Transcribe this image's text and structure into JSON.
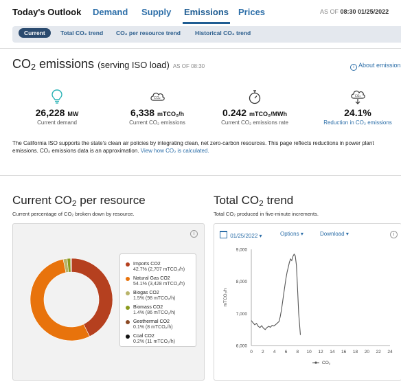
{
  "topnav": {
    "brand": "Today's Outlook",
    "tabs": [
      {
        "label": "Demand"
      },
      {
        "label": "Supply"
      },
      {
        "label": "Emissions"
      },
      {
        "label": "Prices"
      }
    ],
    "asof_prefix": "AS OF",
    "asof_value": "08:30 01/25/2022"
  },
  "subnav": {
    "items": [
      {
        "label": "Current"
      },
      {
        "label": "Total CO₂ trend"
      },
      {
        "label": "CO₂ per resource trend"
      },
      {
        "label": "Historical CO₂ trend"
      }
    ]
  },
  "emissions_header": {
    "title_pre": "CO",
    "title_sub": "2",
    "title_post": " emissions",
    "serving": "(serving ISO load)",
    "asof": "AS OF 08:30",
    "about": "About emissions"
  },
  "kpis": [
    {
      "value": "26,228",
      "unit": "MW",
      "caption": "Current demand",
      "icon": "lightbulb-icon"
    },
    {
      "value": "6,338",
      "unit": "mTCO₂/h",
      "caption": "Current CO₂ emissions",
      "icon": "cloud-co2-icon"
    },
    {
      "value": "0.242",
      "unit": "mTCO₂/MWh",
      "caption": "Current CO₂ emissions rate",
      "icon": "stopwatch-icon"
    },
    {
      "value": "24.1%",
      "unit": "",
      "caption": "Reduction in CO₂ emissions",
      "icon": "cloud-down-icon"
    }
  ],
  "description": {
    "text": "The California ISO supports the state's clean air policies by integrating clean, net zero-carbon resources. This page reflects reductions in power plant emissions. CO₂ emissions data is an approximation.",
    "link": "View how CO₂ is calculated."
  },
  "per_resource": {
    "title_pre": "Current CO",
    "title_sub": "2",
    "title_post": " per resource",
    "subtitle": "Current percentage of CO₂ broken down by resource.",
    "legend": [
      {
        "name": "Imports CO2",
        "detail": "42.7% (2,707 mTCO₂/h)",
        "color": "#b5401f"
      },
      {
        "name": "Natural Gas CO2",
        "detail": "54.1% (3,428 mTCO₂/h)",
        "color": "#e8730c"
      },
      {
        "name": "Biogas CO2",
        "detail": "1.5% (98 mTCO₂/h)",
        "color": "#b9b46a"
      },
      {
        "name": "Biomass CO2",
        "detail": "1.4% (86 mTCO₂/h)",
        "color": "#8a9a1c"
      },
      {
        "name": "Geothermal CO2",
        "detail": "0.1% (8 mTCO₂/h)",
        "color": "#8b4a24"
      },
      {
        "name": "Coal CO2",
        "detail": "0.2% (11 mTCO₂/h)",
        "color": "#111111"
      }
    ]
  },
  "trend": {
    "title_pre": "Total CO",
    "title_sub": "2",
    "title_post": " trend",
    "subtitle": "Total CO₂ produced in five-minute increments.",
    "date": "01/25/2022",
    "options": "Options",
    "download": "Download",
    "ylabel": "mTCO₂/h",
    "legend": "CO₂"
  },
  "chart_data": [
    {
      "type": "pie",
      "title": "",
      "labels": [
        "Imports CO2",
        "Natural Gas CO2",
        "Biogas CO2",
        "Biomass CO2",
        "Geothermal CO2",
        "Coal CO2"
      ],
      "values": [
        2707,
        3428,
        98,
        86,
        8,
        11
      ],
      "colors": [
        "#b5401f",
        "#e8730c",
        "#b9b46a",
        "#8a9a1c",
        "#8b4a24",
        "#111111"
      ],
      "donut": true
    },
    {
      "type": "line",
      "title": "",
      "xlabel": "",
      "ylabel": "mTCO₂/h",
      "xlim": [
        0,
        24
      ],
      "ylim": [
        6000,
        9000
      ],
      "xticks": [
        0,
        2,
        4,
        6,
        8,
        10,
        12,
        14,
        16,
        18,
        20,
        22,
        24
      ],
      "yticks": [
        6000,
        7000,
        8000,
        9000
      ],
      "ytick_labels": [
        "6,000",
        "7,000",
        "8,000",
        "9,000"
      ],
      "grid": false,
      "legend_position": "bottom",
      "series": [
        {
          "name": "CO₂",
          "color": "#555555",
          "x": [
            0,
            0.3,
            0.6,
            0.9,
            1.2,
            1.5,
            1.8,
            2.1,
            2.4,
            2.7,
            3.0,
            3.3,
            3.6,
            3.9,
            4.2,
            4.5,
            4.8,
            5.0,
            5.2,
            5.4,
            5.6,
            5.8,
            6.0,
            6.2,
            6.4,
            6.6,
            6.8,
            7.0,
            7.2,
            7.4,
            7.6,
            7.8,
            8.0,
            8.2,
            8.5
          ],
          "y": [
            6780,
            6710,
            6650,
            6690,
            6600,
            6560,
            6620,
            6540,
            6500,
            6560,
            6600,
            6570,
            6630,
            6610,
            6650,
            6700,
            6750,
            6900,
            7100,
            7350,
            7600,
            7850,
            8100,
            8300,
            8450,
            8600,
            8700,
            8650,
            8780,
            8850,
            8800,
            8500,
            7800,
            7000,
            6330
          ]
        }
      ]
    }
  ]
}
